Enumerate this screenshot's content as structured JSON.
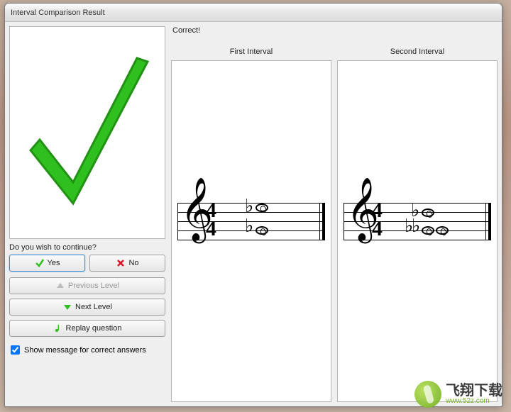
{
  "window": {
    "title": "Interval Comparison Result"
  },
  "feedback": {
    "message": "Correct!"
  },
  "prompt": {
    "continue_question": "Do you wish to continue?"
  },
  "buttons": {
    "yes": "Yes",
    "no": "No",
    "previous_level": "Previous Level",
    "next_level": "Next Level",
    "replay_question": "Replay question"
  },
  "checkbox": {
    "show_message": "Show message for correct answers",
    "checked": true
  },
  "intervals": {
    "first": {
      "label": "First Interval"
    },
    "second": {
      "label": "Second Interval"
    }
  },
  "watermark": {
    "text": "飞翔下载",
    "url": "www.52z.com"
  }
}
